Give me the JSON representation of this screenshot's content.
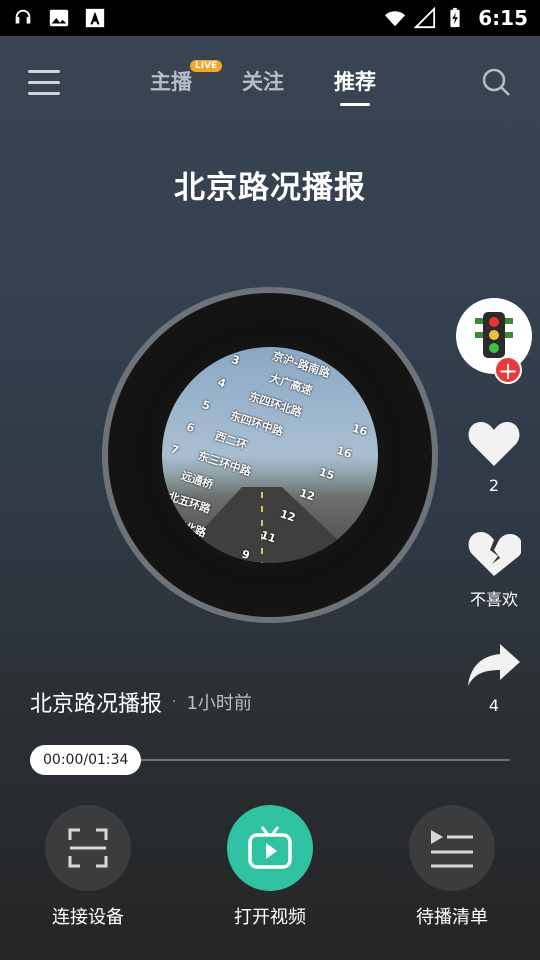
{
  "status_bar": {
    "time": "6:15"
  },
  "nav": {
    "tabs": [
      {
        "label": "主播",
        "badge": "LIVE"
      },
      {
        "label": "关注"
      },
      {
        "label": "推荐"
      }
    ]
  },
  "program": {
    "title": "北京路况播报",
    "name": "北京路况播报",
    "time_ago": "1小时前",
    "separator": "·"
  },
  "disc": {
    "roads": [
      "京沪-路南路",
      "大广高速",
      "东四环北路",
      "东四环中路",
      "西二环",
      "东三环中路",
      "远通桥",
      "北五环路",
      "西四环北路"
    ],
    "numbers": [
      "3",
      "4",
      "5",
      "6",
      "7",
      "16",
      "16",
      "15",
      "12",
      "12",
      "11",
      "9"
    ]
  },
  "side": {
    "like_count": "2",
    "dislike_label": "不喜欢",
    "share_count": "4"
  },
  "player": {
    "time": "00:00/01:34",
    "progress": 0
  },
  "bottom": [
    {
      "label": "连接设备"
    },
    {
      "label": "打开视频"
    },
    {
      "label": "待播清单"
    }
  ],
  "colors": {
    "accent_green": "#2fc2a0",
    "live_orange": "#f5a623",
    "plus_red": "#e83a3a"
  }
}
